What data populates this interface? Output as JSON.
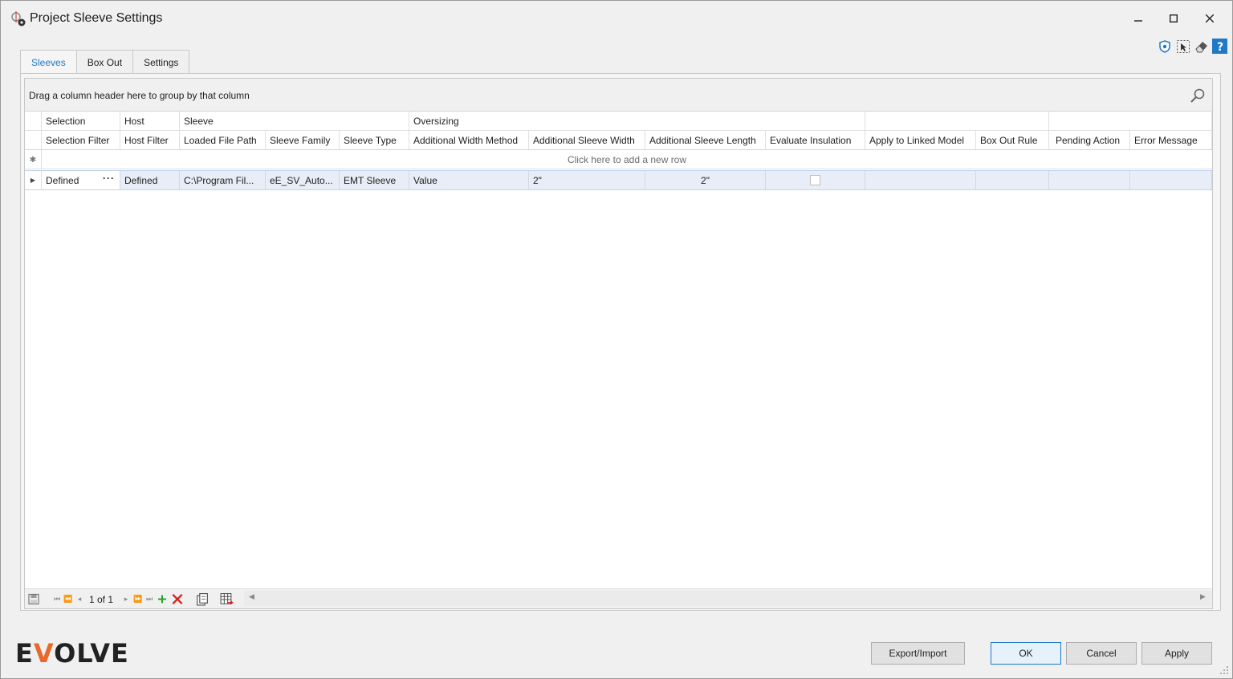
{
  "window": {
    "title": "Project Sleeve Settings",
    "controls": {
      "minimize": "–",
      "maximize": "□",
      "close": "✕"
    }
  },
  "toolbar_icons": [
    "shield-icon",
    "selection-icon",
    "eraser-icon",
    "help-icon"
  ],
  "tabs": [
    {
      "label": "Sleeves",
      "active": true
    },
    {
      "label": "Box Out",
      "active": false
    },
    {
      "label": "Settings",
      "active": false
    }
  ],
  "grid": {
    "group_panel_text": "Drag a column header here to group by that column",
    "bands": [
      "Selection",
      "Host",
      "Sleeve",
      "Oversizing",
      "",
      "",
      ""
    ],
    "columns": [
      "Selection Filter",
      "Host Filter",
      "Loaded File Path",
      "Sleeve Family",
      "Sleeve Type",
      "Additional Width Method",
      "Additional Sleeve Width",
      "Additional Sleeve Length",
      "Evaluate Insulation",
      "Apply to Linked Model",
      "Box Out Rule",
      "Pending Action",
      "Error Message"
    ],
    "new_row_text": "Click here to add a new row",
    "rows": [
      {
        "selection_filter": "Defined",
        "host_filter": "Defined",
        "loaded_file_path": "C:\\Program Fil...",
        "sleeve_family": "eE_SV_Auto...",
        "sleeve_type": "EMT Sleeve",
        "additional_width_method": "Value",
        "additional_sleeve_width": "2\"",
        "additional_sleeve_length": "2\"",
        "evaluate_insulation": false,
        "apply_to_linked_model": "",
        "box_out_rule": "",
        "pending_action": "",
        "error_message": ""
      }
    ],
    "navigator": {
      "record_text": "1 of 1"
    }
  },
  "footer": {
    "logo_text": "EVOLVE",
    "buttons": {
      "export_import": "Export/Import",
      "ok": "OK",
      "cancel": "Cancel",
      "apply": "Apply"
    }
  },
  "colors": {
    "accent": "#1f78c8",
    "logo_v": "#e8692b",
    "selected_row": "#e8eef7"
  }
}
